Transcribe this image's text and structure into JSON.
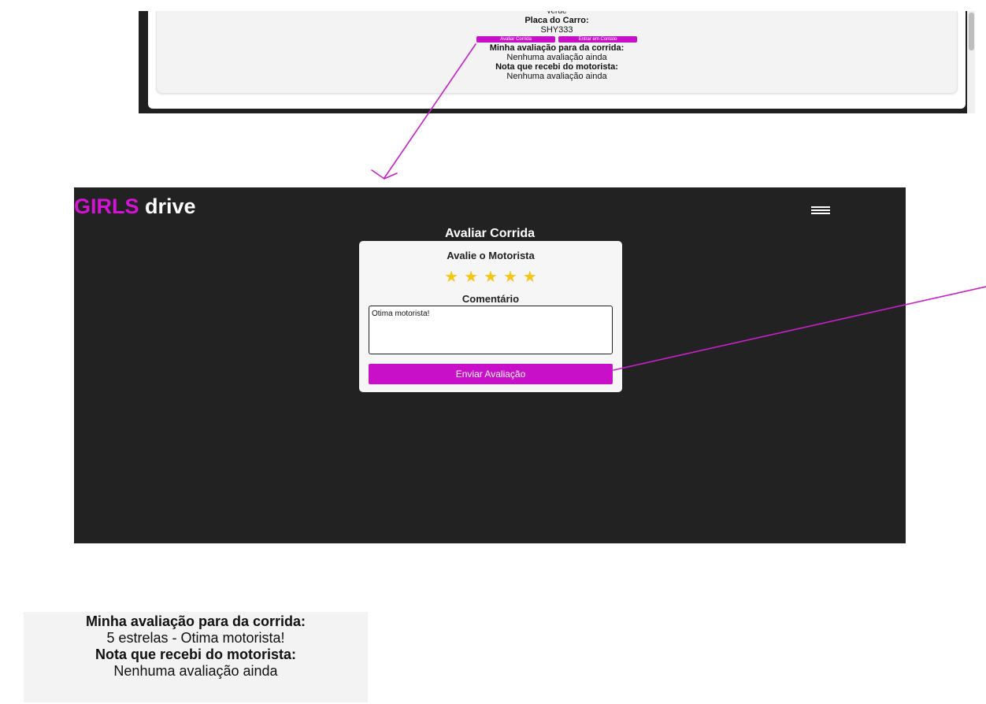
{
  "top_card": {
    "cut_text": "verde",
    "plate_label": "Placa do Carro:",
    "plate_value": "SHY333",
    "buttons": {
      "rate": "Avaliar Corrida",
      "contact": "Entrar em Contato"
    },
    "my_rating_label": "Minha avaliação para da corrida:",
    "my_rating_value": "Nenhuma avaliação ainda",
    "driver_rating_label": "Nota que recebi do motorista:",
    "driver_rating_value": "Nenhuma avaliação ainda"
  },
  "app": {
    "logo": {
      "part1": "GIRLS",
      "part2": "drive"
    },
    "menu_icon": "hamburger-icon",
    "page_title": "Avaliar Corrida",
    "rating_form": {
      "heading": "Avalie o Motorista",
      "stars_selected": 5,
      "stars_total": 5,
      "star_glyph": "★",
      "star_color": "#f5c518",
      "comment_label": "Comentário",
      "comment_value": "Otima motorista!",
      "submit_label": "Enviar Avaliação"
    }
  },
  "bottom_result": {
    "my_rating_label": "Minha avaliação para da corrida:",
    "my_rating_value": "5 estrelas - Otima motorista!",
    "driver_rating_label": "Nota que recebi do motorista:",
    "driver_rating_value": "Nenhuma avaliação ainda"
  },
  "colors": {
    "brand_magenta": "#d413d4",
    "button_magenta": "#c810c8",
    "app_background": "#222222",
    "arrow": "#c820c8"
  }
}
